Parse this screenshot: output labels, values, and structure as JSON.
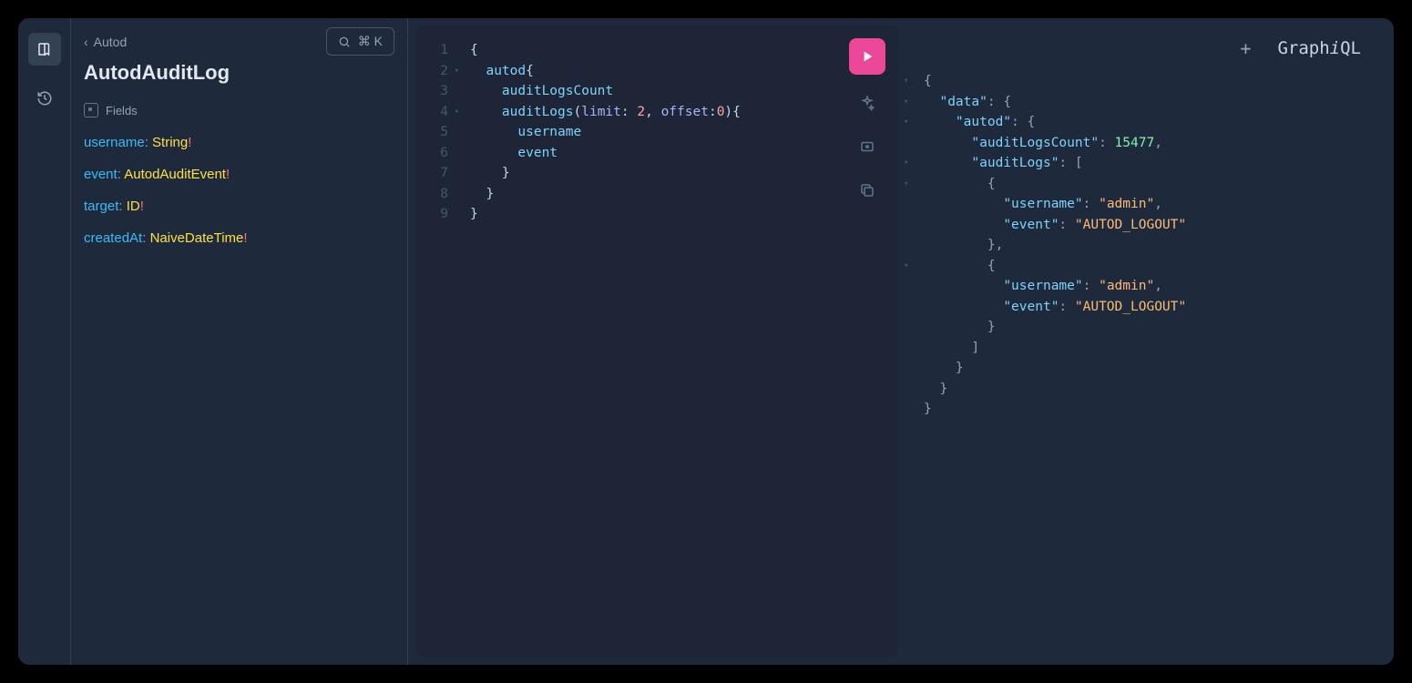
{
  "breadcrumb": {
    "parent": "Autod"
  },
  "page_title": "AutodAuditLog",
  "search": {
    "shortcut": "⌘ K"
  },
  "fields_section_label": "Fields",
  "fields": [
    {
      "name": "username",
      "type": "String",
      "required": true
    },
    {
      "name": "event",
      "type": "AutodAuditEvent",
      "required": true
    },
    {
      "name": "target",
      "type": "ID",
      "required": true
    },
    {
      "name": "createdAt",
      "type": "NaiveDateTime",
      "required": true
    }
  ],
  "brand": "GraphiQL",
  "editor": {
    "lines": [
      {
        "num": "1",
        "fold": false,
        "tokens": [
          [
            "punc",
            "{"
          ]
        ]
      },
      {
        "num": "2",
        "fold": true,
        "tokens": [
          [
            "indent",
            "  "
          ],
          [
            "field",
            "autod"
          ],
          [
            "punc",
            "{"
          ]
        ]
      },
      {
        "num": "3",
        "fold": false,
        "tokens": [
          [
            "indent",
            "    "
          ],
          [
            "field",
            "auditLogsCount"
          ]
        ]
      },
      {
        "num": "4",
        "fold": true,
        "tokens": [
          [
            "indent",
            "    "
          ],
          [
            "field",
            "auditLogs"
          ],
          [
            "punc",
            "("
          ],
          [
            "arg",
            "limit"
          ],
          [
            "punc",
            ": "
          ],
          [
            "num",
            "2"
          ],
          [
            "punc",
            ", "
          ],
          [
            "arg",
            "offset"
          ],
          [
            "punc",
            ":"
          ],
          [
            "num",
            "0"
          ],
          [
            "punc",
            ")"
          ],
          [
            "punc",
            "{"
          ]
        ]
      },
      {
        "num": "5",
        "fold": false,
        "tokens": [
          [
            "indent",
            "      "
          ],
          [
            "field",
            "username"
          ]
        ]
      },
      {
        "num": "6",
        "fold": false,
        "tokens": [
          [
            "indent",
            "      "
          ],
          [
            "field",
            "event"
          ]
        ]
      },
      {
        "num": "7",
        "fold": false,
        "tokens": [
          [
            "indent",
            "    "
          ],
          [
            "punc",
            "}"
          ]
        ]
      },
      {
        "num": "8",
        "fold": false,
        "tokens": [
          [
            "indent",
            "  "
          ],
          [
            "punc",
            "}"
          ]
        ]
      },
      {
        "num": "9",
        "fold": false,
        "tokens": [
          [
            "punc",
            "}"
          ]
        ]
      }
    ]
  },
  "result": {
    "folds": [
      "▾",
      "▾",
      "▾",
      "",
      "▾",
      "▾",
      "",
      "",
      "",
      "▾",
      "",
      "",
      "",
      "",
      "",
      "",
      "",
      ""
    ],
    "lines": [
      [
        [
          "punc",
          "{"
        ]
      ],
      [
        [
          "indent",
          "  "
        ],
        [
          "key",
          "\"data\""
        ],
        [
          "punc",
          ": {"
        ]
      ],
      [
        [
          "indent",
          "    "
        ],
        [
          "key",
          "\"autod\""
        ],
        [
          "punc",
          ": {"
        ]
      ],
      [
        [
          "indent",
          "      "
        ],
        [
          "key",
          "\"auditLogsCount\""
        ],
        [
          "punc",
          ": "
        ],
        [
          "num",
          "15477"
        ],
        [
          "punc",
          ","
        ]
      ],
      [
        [
          "indent",
          "      "
        ],
        [
          "key",
          "\"auditLogs\""
        ],
        [
          "punc",
          ": ["
        ]
      ],
      [
        [
          "indent",
          "        "
        ],
        [
          "punc",
          "{"
        ]
      ],
      [
        [
          "indent",
          "          "
        ],
        [
          "key",
          "\"username\""
        ],
        [
          "punc",
          ": "
        ],
        [
          "str",
          "\"admin\""
        ],
        [
          "punc",
          ","
        ]
      ],
      [
        [
          "indent",
          "          "
        ],
        [
          "key",
          "\"event\""
        ],
        [
          "punc",
          ": "
        ],
        [
          "str",
          "\"AUTOD_LOGOUT\""
        ]
      ],
      [
        [
          "indent",
          "        "
        ],
        [
          "punc",
          "},"
        ]
      ],
      [
        [
          "indent",
          "        "
        ],
        [
          "punc",
          "{"
        ]
      ],
      [
        [
          "indent",
          "          "
        ],
        [
          "key",
          "\"username\""
        ],
        [
          "punc",
          ": "
        ],
        [
          "str",
          "\"admin\""
        ],
        [
          "punc",
          ","
        ]
      ],
      [
        [
          "indent",
          "          "
        ],
        [
          "key",
          "\"event\""
        ],
        [
          "punc",
          ": "
        ],
        [
          "str",
          "\"AUTOD_LOGOUT\""
        ]
      ],
      [
        [
          "indent",
          "        "
        ],
        [
          "punc",
          "}"
        ]
      ],
      [
        [
          "indent",
          "      "
        ],
        [
          "punc",
          "]"
        ]
      ],
      [
        [
          "indent",
          "    "
        ],
        [
          "punc",
          "}"
        ]
      ],
      [
        [
          "indent",
          "  "
        ],
        [
          "punc",
          "}"
        ]
      ],
      [
        [
          "punc",
          "}"
        ]
      ]
    ]
  }
}
